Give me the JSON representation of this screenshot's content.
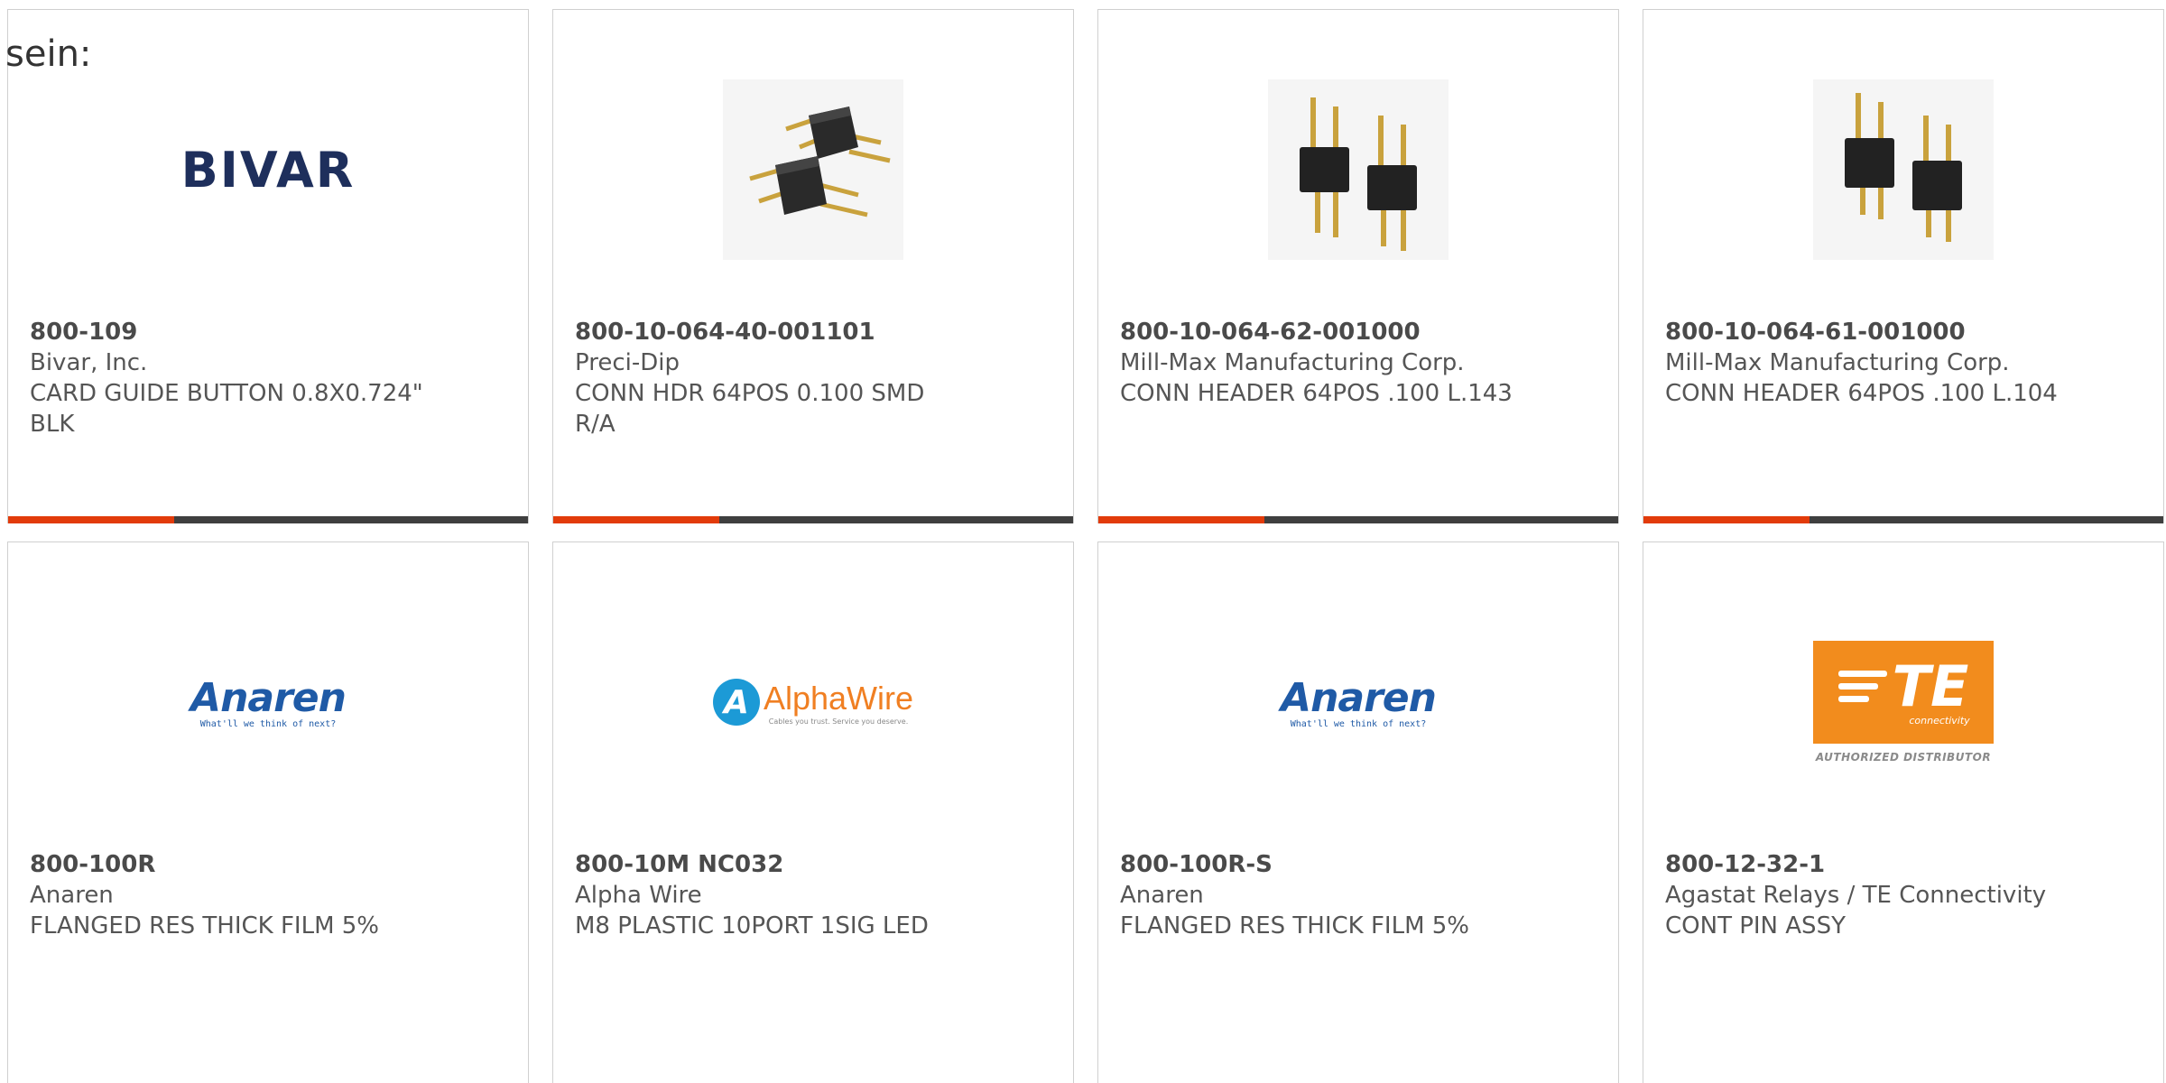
{
  "intro_text": "sein:",
  "colors": {
    "accent": "#e23b0a",
    "bar": "#3f3f3f",
    "bivar_blue": "#1e2f5c",
    "anaren_blue": "#1f5aa6",
    "alphawire_orange": "#f07f22",
    "te_orange": "#f28c1d"
  },
  "products": [
    {
      "part_number": "800-109",
      "manufacturer": "Bivar, Inc.",
      "description": "CARD GUIDE BUTTON 0.8X0.724\" BLK",
      "image": "bivar-logo",
      "logo_text": "BIVAR"
    },
    {
      "part_number": "800-10-064-40-001101",
      "manufacturer": "Preci-Dip",
      "description": "CONN HDR 64POS 0.100 SMD R/A",
      "image": "right-angle-header-photo"
    },
    {
      "part_number": "800-10-064-62-001000",
      "manufacturer": "Mill-Max Manufacturing Corp.",
      "description": "CONN HEADER 64POS .100 L.143",
      "image": "pin-header-photo"
    },
    {
      "part_number": "800-10-064-61-001000",
      "manufacturer": "Mill-Max Manufacturing Corp.",
      "description": "CONN HEADER 64POS .100 L.104",
      "image": "pin-header-photo"
    },
    {
      "part_number": "800-100R",
      "manufacturer": "Anaren",
      "description": "FLANGED RES THICK FILM 5%",
      "image": "anaren-logo",
      "logo_text": "Anaren",
      "logo_tagline": "What'll we think of next?"
    },
    {
      "part_number": "800-10M NC032",
      "manufacturer": "Alpha Wire",
      "description": "M8 PLASTIC 10PORT 1SIG LED",
      "image": "alphawire-logo",
      "logo_text": "AlphaWire",
      "logo_tagline": "Cables you trust. Service you deserve."
    },
    {
      "part_number": "800-100R-S",
      "manufacturer": "Anaren",
      "description": "FLANGED RES THICK FILM 5%",
      "image": "anaren-logo",
      "logo_text": "Anaren",
      "logo_tagline": "What'll we think of next?"
    },
    {
      "part_number": "800-12-32-1",
      "manufacturer": "Agastat Relays / TE Connectivity",
      "description": "CONT PIN ASSY",
      "image": "te-connectivity-logo",
      "logo_text": "TE",
      "logo_subtext": "connectivity",
      "logo_badge": "AUTHORIZED DISTRIBUTOR"
    }
  ]
}
